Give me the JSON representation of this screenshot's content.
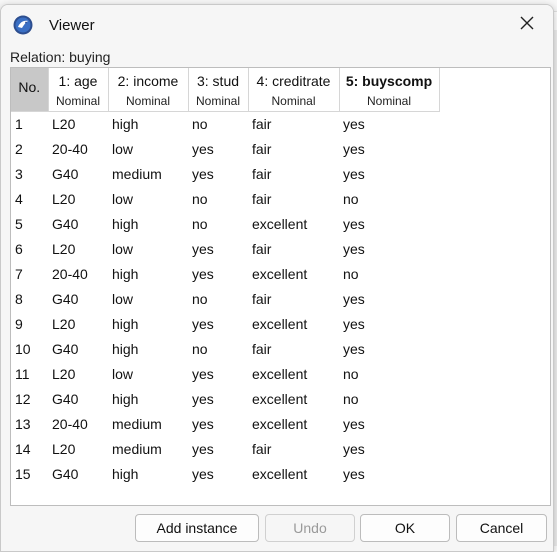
{
  "window": {
    "title": "Viewer",
    "icon": "weka-bird-icon",
    "close_icon": "close-icon"
  },
  "relation": {
    "label": "Relation: buying"
  },
  "table": {
    "no_header": "No.",
    "columns": [
      {
        "name": "1: age",
        "type": "Nominal"
      },
      {
        "name": "2: income",
        "type": "Nominal"
      },
      {
        "name": "3: stud",
        "type": "Nominal"
      },
      {
        "name": "4: creditrate",
        "type": "Nominal"
      },
      {
        "name": "5: buyscomp",
        "type": "Nominal"
      }
    ],
    "rows": [
      [
        "1",
        "L20",
        "high",
        "no",
        "fair",
        "yes"
      ],
      [
        "2",
        "20-40",
        "low",
        "yes",
        "fair",
        "yes"
      ],
      [
        "3",
        "G40",
        "medium",
        "yes",
        "fair",
        "yes"
      ],
      [
        "4",
        "L20",
        "low",
        "no",
        "fair",
        "no"
      ],
      [
        "5",
        "G40",
        "high",
        "no",
        "excellent",
        "yes"
      ],
      [
        "6",
        "L20",
        "low",
        "yes",
        "fair",
        "yes"
      ],
      [
        "7",
        "20-40",
        "high",
        "yes",
        "excellent",
        "no"
      ],
      [
        "8",
        "G40",
        "low",
        "no",
        "fair",
        "yes"
      ],
      [
        "9",
        "L20",
        "high",
        "yes",
        "excellent",
        "yes"
      ],
      [
        "10",
        "G40",
        "high",
        "no",
        "fair",
        "yes"
      ],
      [
        "11",
        "L20",
        "low",
        "yes",
        "excellent",
        "no"
      ],
      [
        "12",
        "G40",
        "high",
        "yes",
        "excellent",
        "no"
      ],
      [
        "13",
        "20-40",
        "medium",
        "yes",
        "excellent",
        "yes"
      ],
      [
        "14",
        "L20",
        "medium",
        "yes",
        "fair",
        "yes"
      ],
      [
        "15",
        "G40",
        "high",
        "yes",
        "excellent",
        "yes"
      ]
    ]
  },
  "buttons": {
    "add_instance": "Add instance",
    "undo": "Undo",
    "ok": "OK",
    "cancel": "Cancel"
  }
}
